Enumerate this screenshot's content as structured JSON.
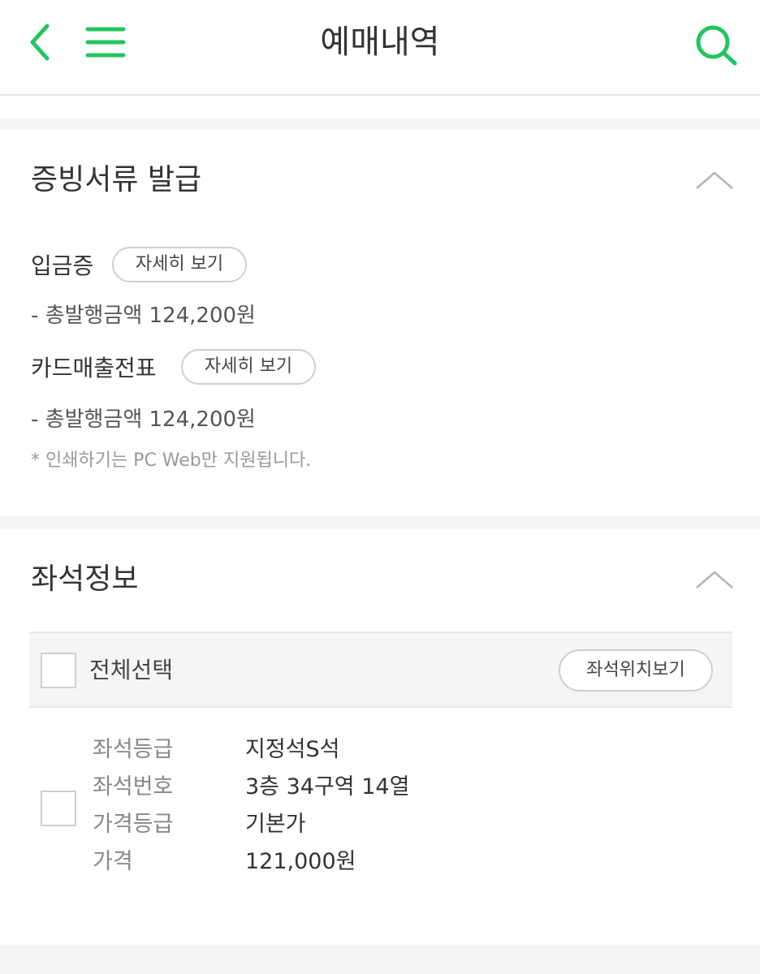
{
  "header": {
    "title": "예매내역",
    "back_icon": "chevron-left-icon",
    "menu_icon": "hamburger-menu-icon",
    "search_icon": "search-icon",
    "accent_color": "#22c55e"
  },
  "documents": {
    "title": "증빙서류 발급",
    "deposit": {
      "label": "입금증",
      "button": "자세히 보기",
      "amount": "- 총발행금액 124,200원"
    },
    "card_receipt": {
      "label": "카드매출전표",
      "button": "자세히 보기",
      "amount": "- 총발행금액 124,200원"
    },
    "note": "* 인쇄하기는 PC Web만 지원됩니다."
  },
  "seat_info": {
    "title": "좌석정보",
    "select_all": "전체선택",
    "location_button": "좌석위치보기",
    "seat": {
      "grade_label": "좌석등급",
      "grade_value": "지정석S석",
      "number_label": "좌석번호",
      "number_value": "3층 34구역 14열",
      "price_grade_label": "가격등급",
      "price_grade_value": "기본가",
      "price_label": "가격",
      "price_value": "121,000원"
    }
  }
}
